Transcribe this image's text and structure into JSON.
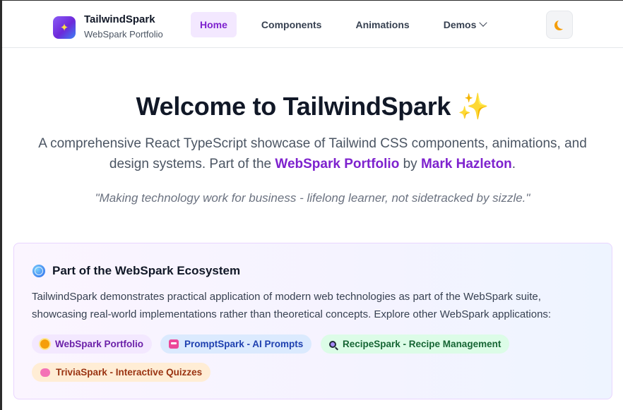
{
  "brand": {
    "title": "TailwindSpark",
    "subtitle": "WebSpark Portfolio",
    "logo_icon": "sparkles-icon"
  },
  "nav": {
    "items": [
      {
        "label": "Home",
        "active": true
      },
      {
        "label": "Components",
        "active": false
      },
      {
        "label": "Animations",
        "active": false
      },
      {
        "label": "Demos",
        "active": false,
        "has_dropdown": true
      }
    ],
    "theme_toggle_icon": "moon-icon"
  },
  "hero": {
    "title": "Welcome to TailwindSpark",
    "title_emoji": "✨",
    "description_pre": "A comprehensive React TypeScript showcase of Tailwind CSS components, animations, and design systems. Part of the",
    "link_portfolio": "WebSpark Portfolio",
    "description_mid": "by",
    "link_author": "Mark Hazleton",
    "description_post": ".",
    "quote": "\"Making technology work for business - lifelong learner, not sidetracked by sizzle.\""
  },
  "ecosystem": {
    "title": "Part of the WebSpark Ecosystem",
    "description": "TailwindSpark demonstrates practical application of modern web technologies as part of the WebSpark suite, showcasing real-world implementations rather than theoretical concepts. Explore other WebSpark applications:",
    "tags": [
      {
        "label": "WebSpark Portfolio",
        "icon": "sun-icon"
      },
      {
        "label": "PromptSpark - AI Prompts",
        "icon": "robot-icon"
      },
      {
        "label": "RecipeSpark - Recipe Management",
        "icon": "magnifier-icon"
      },
      {
        "label": "TriviaSpark - Interactive Quizzes",
        "icon": "brain-icon"
      }
    ]
  },
  "colors": {
    "accent": "#7e22ce",
    "active_nav_bg": "#f3e8ff"
  }
}
